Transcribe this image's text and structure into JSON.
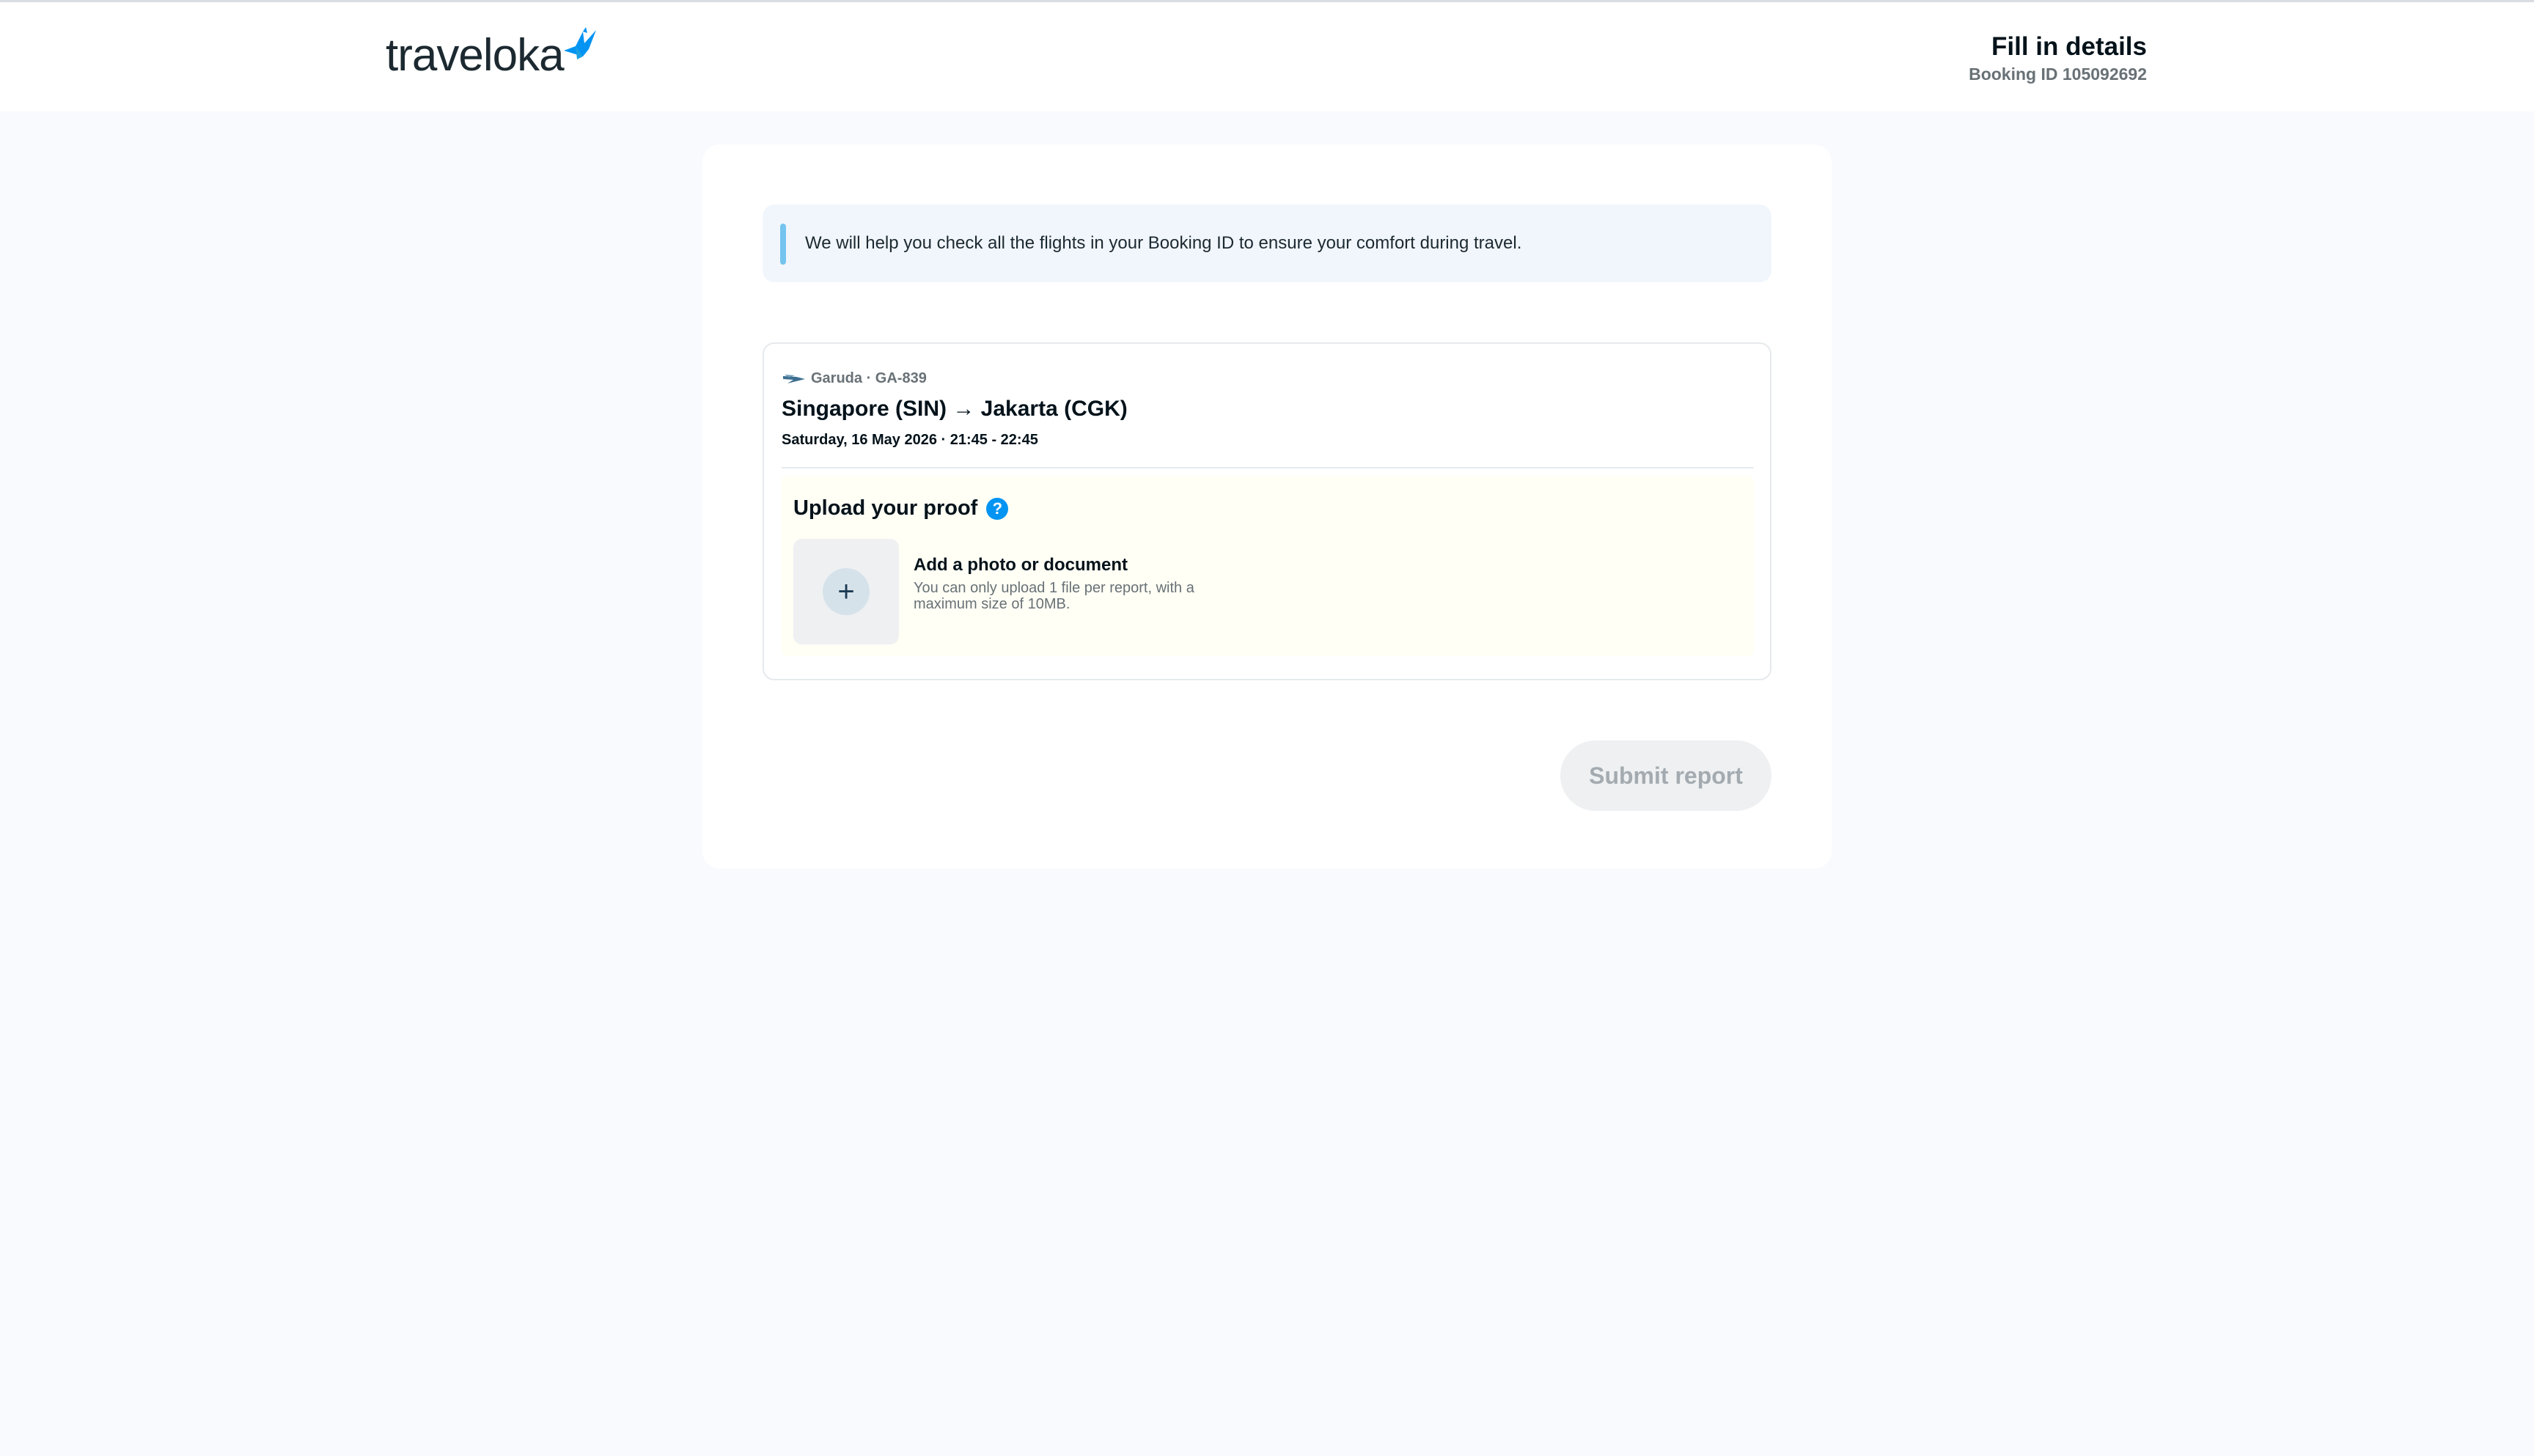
{
  "header": {
    "logo_text": "traveloka",
    "title": "Fill in details",
    "booking_id": "Booking ID 105092692"
  },
  "info_banner": {
    "text": "We will help you check all the flights in your Booking ID to ensure your comfort during travel."
  },
  "flight": {
    "airline": "Garuda · GA-839",
    "route": "Singapore (SIN) → Jakarta (CGK)",
    "datetime": "Saturday, 16 May 2026 · 21:45 - 22:45"
  },
  "upload": {
    "title": "Upload your proof",
    "help_icon": "question-icon",
    "add_label": "Add a photo or document",
    "description": "You can only upload 1 file per report, with a maximum size of 10MB."
  },
  "actions": {
    "submit_label": "Submit report"
  },
  "colors": {
    "brand_blue": "#0194f3",
    "background": "#f8fafd",
    "info_bar": "#74c4ee",
    "upload_bg": "#fffff5"
  }
}
